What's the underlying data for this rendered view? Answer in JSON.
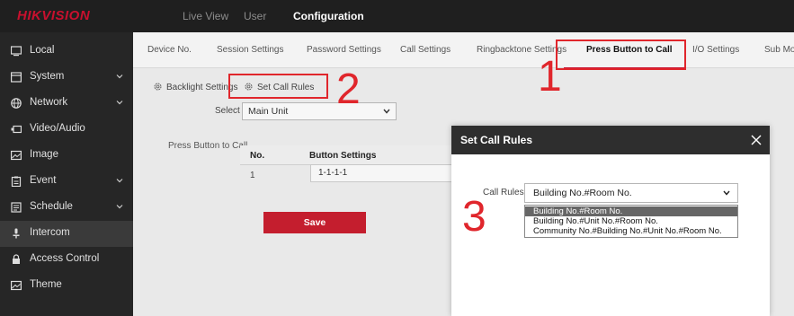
{
  "header": {
    "logo": "HIKVISION",
    "nav": [
      "Live View",
      "User",
      "Configuration"
    ],
    "active_nav": "Configuration"
  },
  "sidebar": {
    "items": [
      {
        "label": "Local",
        "icon": "monitor-icon",
        "expandable": false
      },
      {
        "label": "System",
        "icon": "window-icon",
        "expandable": true
      },
      {
        "label": "Network",
        "icon": "globe-icon",
        "expandable": true
      },
      {
        "label": "Video/Audio",
        "icon": "video-icon",
        "expandable": false
      },
      {
        "label": "Image",
        "icon": "image-icon",
        "expandable": false
      },
      {
        "label": "Event",
        "icon": "clipboard-icon",
        "expandable": true
      },
      {
        "label": "Schedule",
        "icon": "schedule-icon",
        "expandable": true
      },
      {
        "label": "Intercom",
        "icon": "person-icon",
        "expandable": false
      },
      {
        "label": "Access Control",
        "icon": "lock-icon",
        "expandable": false
      },
      {
        "label": "Theme",
        "icon": "image-icon",
        "expandable": false
      }
    ],
    "active": "Intercom"
  },
  "tabs": {
    "items": [
      "Device No.",
      "Session Settings",
      "Password Settings",
      "Call Settings",
      "Ringbacktone Settings",
      "Press Button to Call",
      "I/O Settings",
      "Sub Mo"
    ],
    "active": "Press Button to Call"
  },
  "subtabs": {
    "backlight": "Backlight Settings",
    "call_rules": "Set Call Rules"
  },
  "form": {
    "select_label": "Select",
    "select_value": "Main Unit",
    "press_button_label": "Press Button to Call",
    "table": {
      "headers": [
        "No.",
        "Button Settings"
      ],
      "rows": [
        {
          "no": "1",
          "value": "1-1-1-1"
        }
      ]
    },
    "save_label": "Save"
  },
  "annotations": [
    "1",
    "2",
    "3"
  ],
  "dialog": {
    "title": "Set Call Rules",
    "field_label": "Call Rules",
    "selected": "Building No.#Room No.",
    "options": [
      "Building No.#Room No.",
      "Building No.#Unit No.#Room No.",
      "Community No.#Building No.#Unit No.#Room No."
    ]
  },
  "colors": {
    "accent_red": "#c8102e",
    "annotation_red": "#e0262c",
    "topbar": "#1f1f1f",
    "sidebar": "#262626"
  }
}
